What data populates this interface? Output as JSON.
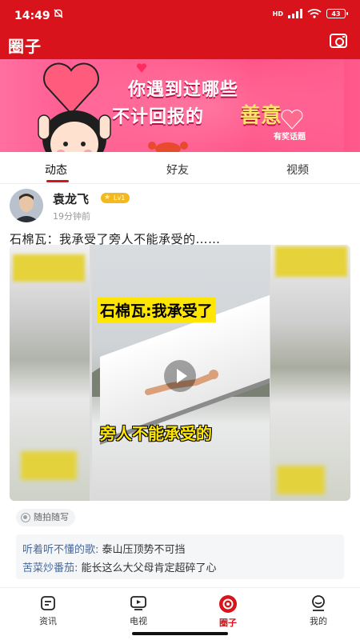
{
  "status_bar": {
    "time": "14:49",
    "network": "HD",
    "battery": "43"
  },
  "header": {
    "title": "圈子"
  },
  "banner": {
    "line1": "你遇到过哪些",
    "line2_plain": "不计回报的",
    "line2_highlight": "善意",
    "tag": "有奖话题"
  },
  "tabs": [
    {
      "label": "动态",
      "active": true
    },
    {
      "label": "好友",
      "active": false
    },
    {
      "label": "视频",
      "active": false
    }
  ],
  "post": {
    "author": "袁龙飞",
    "level": "Lv1",
    "time_ago": "19分钟前",
    "text": "石棉瓦：我承受了旁人不能承受的……",
    "video_caption_top": "石棉瓦:我承受了",
    "video_caption_bottom": "旁人不能承受的",
    "tag_chip": "随拍随写",
    "comments": [
      {
        "user": "听着听不懂的歌:",
        "text": "泰山压顶势不可挡"
      },
      {
        "user": "苦菜炒番茄:",
        "text": "能长这么大父母肯定超碎了心"
      }
    ]
  },
  "bottom_nav": [
    {
      "label": "资讯",
      "icon": "news-icon",
      "active": false
    },
    {
      "label": "电视",
      "icon": "tv-icon",
      "active": false
    },
    {
      "label": "圈子",
      "icon": "circle-icon",
      "active": true
    },
    {
      "label": "我的",
      "icon": "profile-icon",
      "active": false
    }
  ],
  "colors": {
    "brand_red": "#d8131b",
    "banner_pink": "#ff4f87",
    "highlight_yellow": "#ffe36b"
  }
}
